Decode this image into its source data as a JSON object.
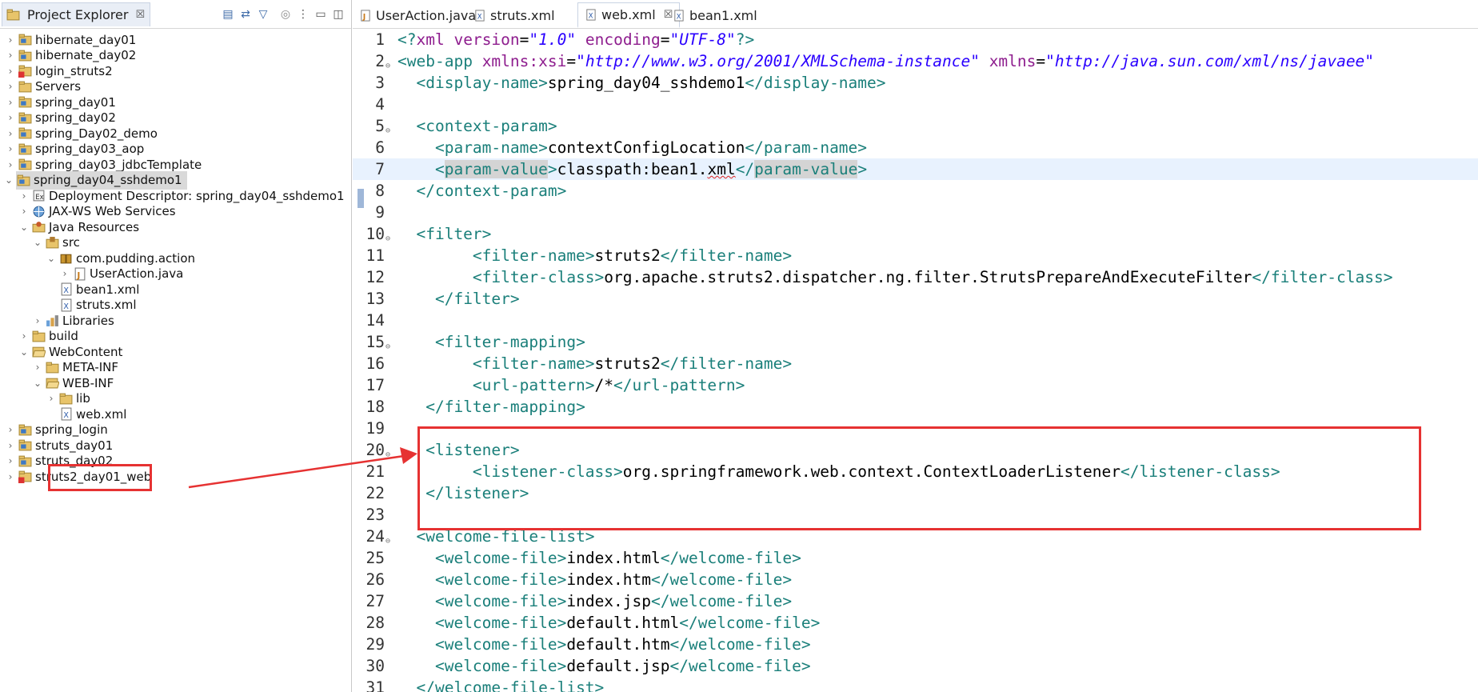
{
  "explorer": {
    "title": "Project Explorer",
    "close": "☒",
    "toolbar": [
      "collapse-all-icon",
      "link-with-editor-icon",
      "filter-icon",
      "focus-icon",
      "view-menu-icon",
      "minimize-icon",
      "maximize-icon"
    ],
    "tree": [
      {
        "label": "hibernate_day01",
        "depth": 0,
        "twisty": "›",
        "icon": "project",
        "selected": false
      },
      {
        "label": "hibernate_day02",
        "depth": 0,
        "twisty": "›",
        "icon": "project",
        "selected": false
      },
      {
        "label": "login_struts2",
        "depth": 0,
        "twisty": "›",
        "icon": "project-error",
        "selected": false
      },
      {
        "label": "Servers",
        "depth": 0,
        "twisty": "›",
        "icon": "folder",
        "selected": false
      },
      {
        "label": "spring_day01",
        "depth": 0,
        "twisty": "›",
        "icon": "project",
        "selected": false
      },
      {
        "label": "spring_day02",
        "depth": 0,
        "twisty": "›",
        "icon": "project",
        "selected": false
      },
      {
        "label": "spring_Day02_demo",
        "depth": 0,
        "twisty": "›",
        "icon": "project",
        "selected": false
      },
      {
        "label": "spring_day03_aop",
        "depth": 0,
        "twisty": "›",
        "icon": "project",
        "selected": false
      },
      {
        "label": "spring_day03_jdbcTemplate",
        "depth": 0,
        "twisty": "›",
        "icon": "project",
        "selected": false
      },
      {
        "label": "spring_day04_sshdemo1",
        "depth": 0,
        "twisty": "⌄",
        "icon": "project",
        "selected": true
      },
      {
        "label": "Deployment Descriptor: spring_day04_sshdemo1",
        "depth": 1,
        "twisty": "›",
        "icon": "deploy",
        "selected": false
      },
      {
        "label": "JAX-WS Web Services",
        "depth": 1,
        "twisty": "›",
        "icon": "webservice",
        "selected": false
      },
      {
        "label": "Java Resources",
        "depth": 1,
        "twisty": "⌄",
        "icon": "java-resources",
        "selected": false
      },
      {
        "label": "src",
        "depth": 2,
        "twisty": "⌄",
        "icon": "source-folder",
        "selected": false
      },
      {
        "label": "com.pudding.action",
        "depth": 3,
        "twisty": "⌄",
        "icon": "package",
        "selected": false
      },
      {
        "label": "UserAction.java",
        "depth": 4,
        "twisty": "›",
        "icon": "java-file",
        "selected": false
      },
      {
        "label": "bean1.xml",
        "depth": 3,
        "twisty": "",
        "icon": "xml-file",
        "selected": false
      },
      {
        "label": "struts.xml",
        "depth": 3,
        "twisty": "",
        "icon": "xml-file",
        "selected": false
      },
      {
        "label": "Libraries",
        "depth": 2,
        "twisty": "›",
        "icon": "libraries",
        "selected": false
      },
      {
        "label": "build",
        "depth": 1,
        "twisty": "›",
        "icon": "folder",
        "selected": false
      },
      {
        "label": "WebContent",
        "depth": 1,
        "twisty": "⌄",
        "icon": "folder-open",
        "selected": false
      },
      {
        "label": "META-INF",
        "depth": 2,
        "twisty": "›",
        "icon": "folder",
        "selected": false
      },
      {
        "label": "WEB-INF",
        "depth": 2,
        "twisty": "⌄",
        "icon": "folder-open",
        "selected": false
      },
      {
        "label": "lib",
        "depth": 3,
        "twisty": "›",
        "icon": "folder",
        "selected": false
      },
      {
        "label": "web.xml",
        "depth": 3,
        "twisty": "",
        "icon": "xml-file",
        "selected": false
      },
      {
        "label": "spring_login",
        "depth": 0,
        "twisty": "›",
        "icon": "project",
        "selected": false
      },
      {
        "label": "struts_day01",
        "depth": 0,
        "twisty": "›",
        "icon": "project",
        "selected": false
      },
      {
        "label": "struts_day02",
        "depth": 0,
        "twisty": "›",
        "icon": "project",
        "selected": false
      },
      {
        "label": "struts2_day01_web",
        "depth": 0,
        "twisty": "›",
        "icon": "project-error",
        "selected": false
      }
    ]
  },
  "editor": {
    "tabs": [
      {
        "label": "UserAction.java",
        "icon": "java-file",
        "active": false,
        "close": ""
      },
      {
        "label": "struts.xml",
        "icon": "xml-file",
        "active": false,
        "close": ""
      },
      {
        "label": "web.xml",
        "icon": "xml-file",
        "active": true,
        "close": "☒"
      },
      {
        "label": "bean1.xml",
        "icon": "xml-file",
        "active": false,
        "close": ""
      }
    ],
    "current_line": 7,
    "lines": [
      {
        "n": "1",
        "fold": false,
        "segs": [
          [
            "t",
            "<?"
          ],
          [
            "k",
            "xml"
          ],
          [
            "c",
            " "
          ],
          [
            "a",
            "version"
          ],
          [
            "c",
            "="
          ],
          [
            "s",
            "\"1.0\""
          ],
          [
            "c",
            " "
          ],
          [
            "a",
            "encoding"
          ],
          [
            "c",
            "="
          ],
          [
            "s",
            "\"UTF-8\""
          ],
          [
            "t",
            "?>"
          ]
        ]
      },
      {
        "n": "2",
        "fold": true,
        "segs": [
          [
            "t",
            "<"
          ],
          [
            "t",
            "web-app"
          ],
          [
            "c",
            " "
          ],
          [
            "a",
            "xmlns:xsi"
          ],
          [
            "c",
            "="
          ],
          [
            "s",
            "\"http://www.w3.org/2001/XMLSchema-instance\""
          ],
          [
            "c",
            " "
          ],
          [
            "a",
            "xmlns"
          ],
          [
            "c",
            "="
          ],
          [
            "s",
            "\"http://java.sun.com/xml/ns/javaee\""
          ]
        ]
      },
      {
        "n": "3",
        "fold": false,
        "segs": [
          [
            "c",
            "  "
          ],
          [
            "t",
            "<display-name>"
          ],
          [
            "c",
            "spring_day04_sshdemo1"
          ],
          [
            "t",
            "</display-name>"
          ]
        ]
      },
      {
        "n": "4",
        "fold": false,
        "segs": []
      },
      {
        "n": "5",
        "fold": true,
        "segs": [
          [
            "c",
            "  "
          ],
          [
            "t",
            "<context-param>"
          ]
        ]
      },
      {
        "n": "6",
        "fold": false,
        "segs": [
          [
            "c",
            "    "
          ],
          [
            "t",
            "<param-name>"
          ],
          [
            "c",
            "contextConfigLocation"
          ],
          [
            "t",
            "</param-name>"
          ]
        ]
      },
      {
        "n": "7",
        "fold": false,
        "segs": [
          [
            "c",
            "    "
          ],
          [
            "t",
            "<"
          ],
          [
            "thl",
            "param-value"
          ],
          [
            "t",
            ">"
          ],
          [
            "c",
            "classpath:bean1."
          ],
          [
            "cerr",
            "xml"
          ],
          [
            "t",
            "</"
          ],
          [
            "thl",
            "param-value"
          ],
          [
            "t",
            ">"
          ]
        ]
      },
      {
        "n": "8",
        "fold": false,
        "segs": [
          [
            "c",
            "  "
          ],
          [
            "t",
            "</context-param>"
          ]
        ]
      },
      {
        "n": "9",
        "fold": false,
        "segs": []
      },
      {
        "n": "10",
        "fold": true,
        "segs": [
          [
            "c",
            "  "
          ],
          [
            "t",
            "<filter>"
          ]
        ]
      },
      {
        "n": "11",
        "fold": false,
        "segs": [
          [
            "c",
            "        "
          ],
          [
            "t",
            "<filter-name>"
          ],
          [
            "c",
            "struts2"
          ],
          [
            "t",
            "</filter-name>"
          ]
        ]
      },
      {
        "n": "12",
        "fold": false,
        "segs": [
          [
            "c",
            "        "
          ],
          [
            "t",
            "<filter-class>"
          ],
          [
            "c",
            "org.apache.struts2.dispatcher.ng.filter.StrutsPrepareAndExecuteFilter"
          ],
          [
            "t",
            "</filter-class>"
          ]
        ]
      },
      {
        "n": "13",
        "fold": false,
        "segs": [
          [
            "c",
            "    "
          ],
          [
            "t",
            "</filter>"
          ]
        ]
      },
      {
        "n": "14",
        "fold": false,
        "segs": []
      },
      {
        "n": "15",
        "fold": true,
        "segs": [
          [
            "c",
            "    "
          ],
          [
            "t",
            "<filter-mapping>"
          ]
        ]
      },
      {
        "n": "16",
        "fold": false,
        "segs": [
          [
            "c",
            "        "
          ],
          [
            "t",
            "<filter-name>"
          ],
          [
            "c",
            "struts2"
          ],
          [
            "t",
            "</filter-name>"
          ]
        ]
      },
      {
        "n": "17",
        "fold": false,
        "segs": [
          [
            "c",
            "        "
          ],
          [
            "t",
            "<url-pattern>"
          ],
          [
            "c",
            "/*"
          ],
          [
            "t",
            "</url-pattern>"
          ]
        ]
      },
      {
        "n": "18",
        "fold": false,
        "segs": [
          [
            "c",
            "   "
          ],
          [
            "t",
            "</filter-mapping>"
          ]
        ]
      },
      {
        "n": "19",
        "fold": false,
        "segs": []
      },
      {
        "n": "20",
        "fold": true,
        "segs": [
          [
            "c",
            "   "
          ],
          [
            "t",
            "<listener>"
          ]
        ]
      },
      {
        "n": "21",
        "fold": false,
        "segs": [
          [
            "c",
            "        "
          ],
          [
            "t",
            "<listener-class>"
          ],
          [
            "c",
            "org.springframework.web.context.ContextLoaderListener"
          ],
          [
            "t",
            "</listener-class>"
          ]
        ]
      },
      {
        "n": "22",
        "fold": false,
        "segs": [
          [
            "c",
            "   "
          ],
          [
            "t",
            "</listener>"
          ]
        ]
      },
      {
        "n": "23",
        "fold": false,
        "segs": []
      },
      {
        "n": "24",
        "fold": true,
        "segs": [
          [
            "c",
            "  "
          ],
          [
            "t",
            "<welcome-file-list>"
          ]
        ]
      },
      {
        "n": "25",
        "fold": false,
        "segs": [
          [
            "c",
            "    "
          ],
          [
            "t",
            "<welcome-file>"
          ],
          [
            "c",
            "index.html"
          ],
          [
            "t",
            "</welcome-file>"
          ]
        ]
      },
      {
        "n": "26",
        "fold": false,
        "segs": [
          [
            "c",
            "    "
          ],
          [
            "t",
            "<welcome-file>"
          ],
          [
            "c",
            "index.htm"
          ],
          [
            "t",
            "</welcome-file>"
          ]
        ]
      },
      {
        "n": "27",
        "fold": false,
        "segs": [
          [
            "c",
            "    "
          ],
          [
            "t",
            "<welcome-file>"
          ],
          [
            "c",
            "index.jsp"
          ],
          [
            "t",
            "</welcome-file>"
          ]
        ]
      },
      {
        "n": "28",
        "fold": false,
        "segs": [
          [
            "c",
            "    "
          ],
          [
            "t",
            "<welcome-file>"
          ],
          [
            "c",
            "default.html"
          ],
          [
            "t",
            "</welcome-file>"
          ]
        ]
      },
      {
        "n": "29",
        "fold": false,
        "segs": [
          [
            "c",
            "    "
          ],
          [
            "t",
            "<welcome-file>"
          ],
          [
            "c",
            "default.htm"
          ],
          [
            "t",
            "</welcome-file>"
          ]
        ]
      },
      {
        "n": "30",
        "fold": false,
        "segs": [
          [
            "c",
            "    "
          ],
          [
            "t",
            "<welcome-file>"
          ],
          [
            "c",
            "default.jsp"
          ],
          [
            "t",
            "</welcome-file>"
          ]
        ]
      },
      {
        "n": "31",
        "fold": false,
        "segs": [
          [
            "c",
            "  "
          ],
          [
            "t",
            "</welcome-file-list>"
          ]
        ]
      }
    ]
  },
  "annotation_color": "#e63232",
  "colors": {
    "tag": "#1a7f7a",
    "attr": "#8e1d8e",
    "string": "#2a00ff",
    "selection": "#d9d9d9",
    "current_line": "#e8f2fe"
  }
}
